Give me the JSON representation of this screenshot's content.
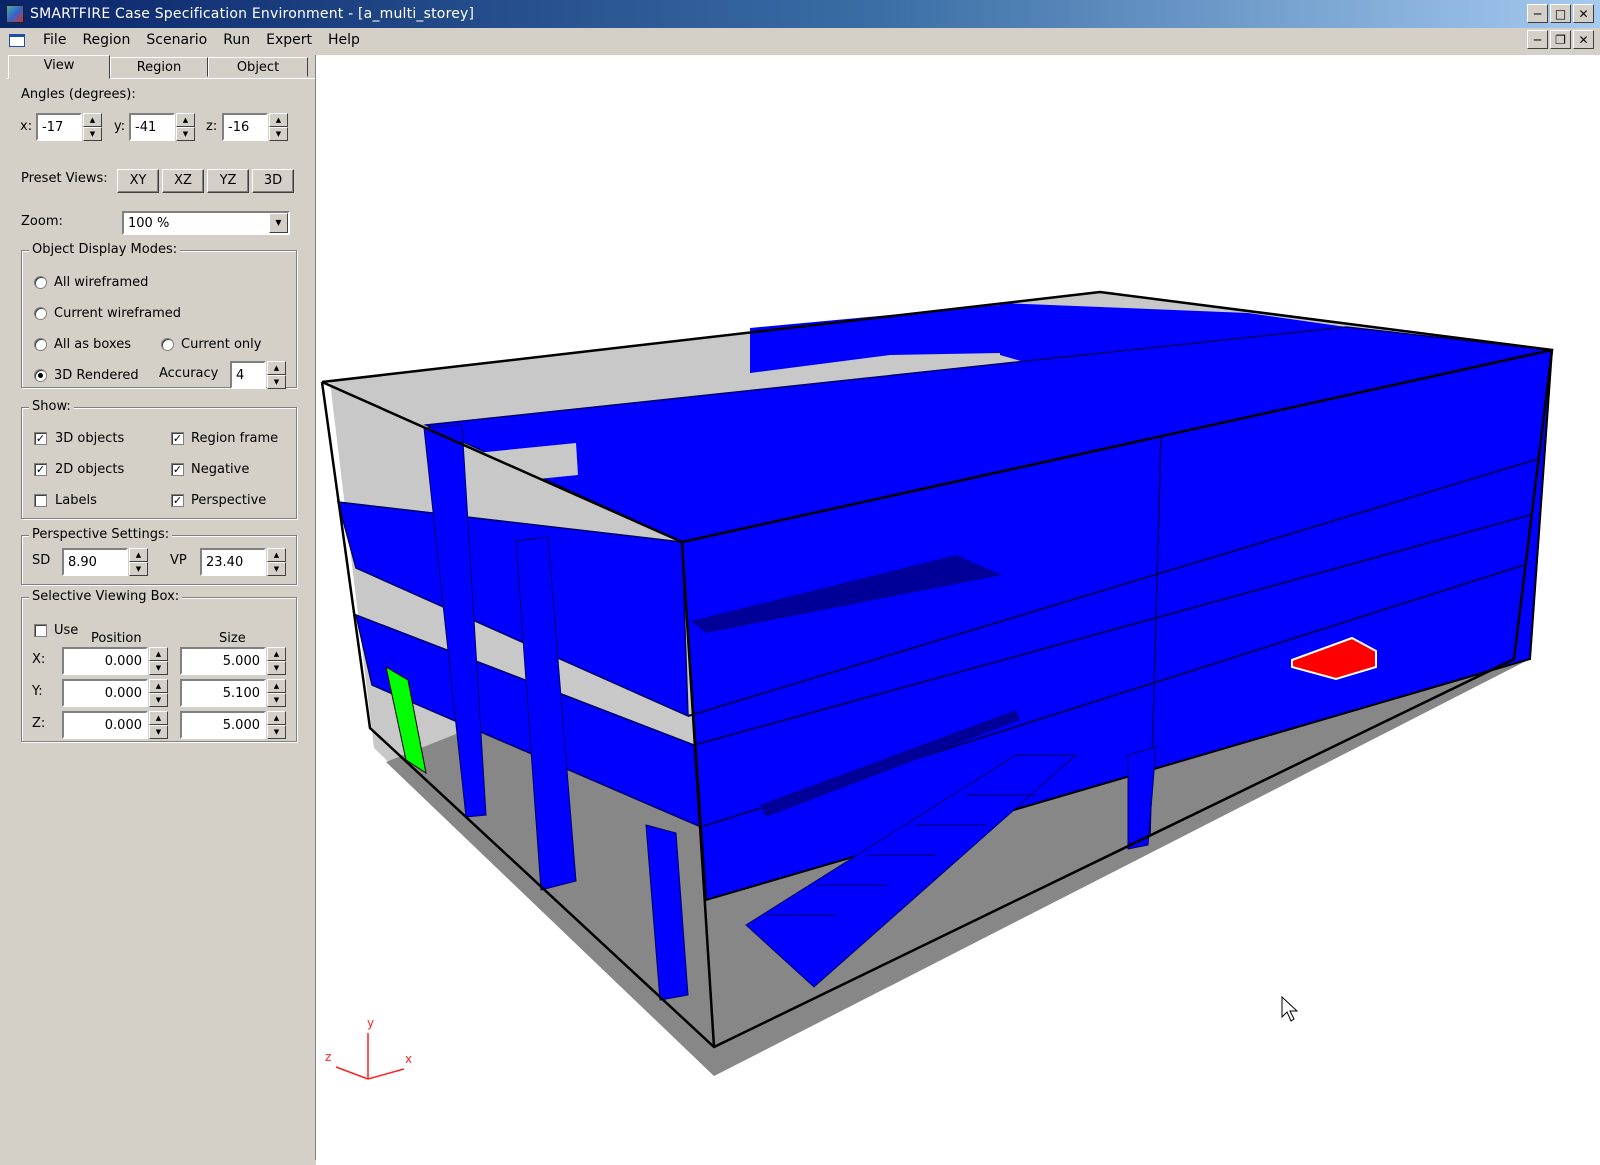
{
  "window": {
    "title": "SMARTFIRE Case Specification Environment - [a_multi_storey]",
    "min": "0",
    "max": "1",
    "close": "r",
    "restore": "2"
  },
  "menu": [
    "File",
    "Region",
    "Scenario",
    "Run",
    "Expert",
    "Help"
  ],
  "tabs": [
    "View",
    "Region",
    "Object"
  ],
  "angles": {
    "label": "Angles (degrees):",
    "x_label": "x:",
    "x": "-17",
    "y_label": "y:",
    "y": "-41",
    "z_label": "z:",
    "z": "-16"
  },
  "preset": {
    "label": "Preset Views:",
    "buttons": [
      "XY",
      "XZ",
      "YZ",
      "3D"
    ]
  },
  "zoom": {
    "label": "Zoom:",
    "value": "100 %"
  },
  "display_modes": {
    "title": "Object Display Modes:",
    "all_wireframed": "All wireframed",
    "current_wireframed": "Current wireframed",
    "all_as_boxes": "All as boxes",
    "current_only": "Current only",
    "rendered": "3D Rendered",
    "accuracy_label": "Accuracy",
    "accuracy": "4",
    "selected": "3D Rendered"
  },
  "show": {
    "title": "Show:",
    "objects_3d": "3D objects",
    "objects_3d_checked": true,
    "objects_2d": "2D objects",
    "objects_2d_checked": true,
    "labels": "Labels",
    "labels_checked": false,
    "region_frame": "Region frame",
    "region_frame_checked": true,
    "negative": "Negative",
    "negative_checked": true,
    "perspective": "Perspective",
    "perspective_checked": true
  },
  "perspective": {
    "title": "Perspective Settings:",
    "sd_label": "SD",
    "sd": "8.90",
    "vp_label": "VP",
    "vp": "23.40"
  },
  "selective_box": {
    "title": "Selective Viewing Box:",
    "use": "Use",
    "use_checked": false,
    "position_header": "Position",
    "size_header": "Size",
    "x_label": "X:",
    "y_label": "Y:",
    "z_label": "Z:",
    "x_pos": "0.000",
    "y_pos": "0.000",
    "z_pos": "0.000",
    "x_size": "5.000",
    "y_size": "5.100",
    "z_size": "5.000"
  },
  "axes": {
    "x": "x",
    "y": "y",
    "z": "z"
  },
  "colors": {
    "wall": "#0000ff",
    "wall_dark": "#000099",
    "floor": "#878787",
    "vent": "#00ff00",
    "fire": "#ff0000"
  }
}
